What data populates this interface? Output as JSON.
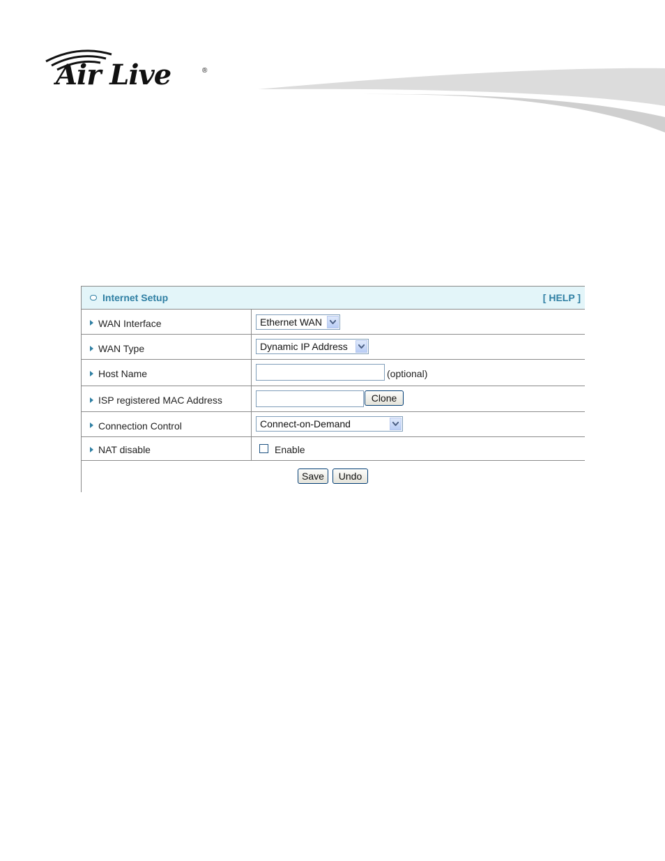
{
  "brand": {
    "name": "Air Live",
    "registered": "®"
  },
  "panel": {
    "title": "Internet Setup",
    "help_link": "[ HELP ]",
    "rows": [
      {
        "label": "WAN Interface",
        "select_value": "Ethernet WAN"
      },
      {
        "label": "WAN Type",
        "select_value": "Dynamic IP Address"
      },
      {
        "label": "Host Name",
        "input_value": "",
        "hint": "(optional)"
      },
      {
        "label": "ISP registered MAC Address",
        "input_value": "",
        "button": "Clone"
      },
      {
        "label": "Connection Control",
        "select_value": "Connect-on-Demand"
      },
      {
        "label": "NAT disable",
        "checkbox_label": "Enable",
        "checked": false
      }
    ],
    "actions": {
      "save": "Save",
      "undo": "Undo"
    }
  },
  "colors": {
    "accent": "#2f7fa3",
    "header_bg": "#e3f5f9",
    "border": "#8a8a8a"
  },
  "icons": [
    "airlive-logo",
    "header-bullet-icon",
    "row-arrow-icon",
    "dropdown-arrow-icon"
  ]
}
